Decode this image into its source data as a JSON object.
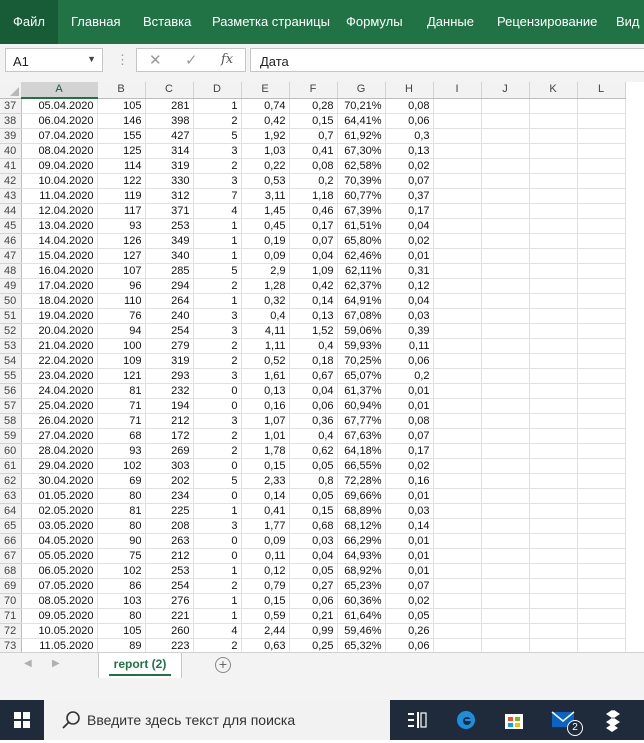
{
  "ribbon": {
    "tabs": [
      "Файл",
      "Главная",
      "Вставка",
      "Разметка страницы",
      "Формулы",
      "Данные",
      "Рецензирование",
      "Вид"
    ],
    "accent": "#217346"
  },
  "formula_bar": {
    "name_box": "A1",
    "cancel_icon": "close-icon",
    "enter_icon": "check-icon",
    "fx_label": "fx",
    "value": "Дата"
  },
  "grid": {
    "columns": [
      "A",
      "B",
      "C",
      "D",
      "E",
      "F",
      "G",
      "H",
      "I",
      "J",
      "K",
      "L"
    ],
    "rows": [
      [
        "37",
        "05.04.2020",
        "105",
        "281",
        "1",
        "0,74",
        "0,28",
        "70,21%",
        "0,08"
      ],
      [
        "38",
        "06.04.2020",
        "146",
        "398",
        "2",
        "0,42",
        "0,15",
        "64,41%",
        "0,06"
      ],
      [
        "39",
        "07.04.2020",
        "155",
        "427",
        "5",
        "1,92",
        "0,7",
        "61,92%",
        "0,3"
      ],
      [
        "40",
        "08.04.2020",
        "125",
        "314",
        "3",
        "1,03",
        "0,41",
        "67,30%",
        "0,13"
      ],
      [
        "41",
        "09.04.2020",
        "114",
        "319",
        "2",
        "0,22",
        "0,08",
        "62,58%",
        "0,02"
      ],
      [
        "42",
        "10.04.2020",
        "122",
        "330",
        "3",
        "0,53",
        "0,2",
        "70,39%",
        "0,07"
      ],
      [
        "43",
        "11.04.2020",
        "119",
        "312",
        "7",
        "3,11",
        "1,18",
        "60,77%",
        "0,37"
      ],
      [
        "44",
        "12.04.2020",
        "117",
        "371",
        "4",
        "1,45",
        "0,46",
        "67,39%",
        "0,17"
      ],
      [
        "45",
        "13.04.2020",
        "93",
        "253",
        "1",
        "0,45",
        "0,17",
        "61,51%",
        "0,04"
      ],
      [
        "46",
        "14.04.2020",
        "126",
        "349",
        "1",
        "0,19",
        "0,07",
        "65,80%",
        "0,02"
      ],
      [
        "47",
        "15.04.2020",
        "127",
        "340",
        "1",
        "0,09",
        "0,04",
        "62,46%",
        "0,01"
      ],
      [
        "48",
        "16.04.2020",
        "107",
        "285",
        "5",
        "2,9",
        "1,09",
        "62,11%",
        "0,31"
      ],
      [
        "49",
        "17.04.2020",
        "96",
        "294",
        "2",
        "1,28",
        "0,42",
        "62,37%",
        "0,12"
      ],
      [
        "50",
        "18.04.2020",
        "110",
        "264",
        "1",
        "0,32",
        "0,14",
        "64,91%",
        "0,04"
      ],
      [
        "51",
        "19.04.2020",
        "76",
        "240",
        "3",
        "0,4",
        "0,13",
        "67,08%",
        "0,03"
      ],
      [
        "52",
        "20.04.2020",
        "94",
        "254",
        "3",
        "4,11",
        "1,52",
        "59,06%",
        "0,39"
      ],
      [
        "53",
        "21.04.2020",
        "100",
        "279",
        "2",
        "1,11",
        "0,4",
        "59,93%",
        "0,11"
      ],
      [
        "54",
        "22.04.2020",
        "109",
        "319",
        "2",
        "0,52",
        "0,18",
        "70,25%",
        "0,06"
      ],
      [
        "55",
        "23.04.2020",
        "121",
        "293",
        "3",
        "1,61",
        "0,67",
        "65,07%",
        "0,2"
      ],
      [
        "56",
        "24.04.2020",
        "81",
        "232",
        "0",
        "0,13",
        "0,04",
        "61,37%",
        "0,01"
      ],
      [
        "57",
        "25.04.2020",
        "71",
        "194",
        "0",
        "0,16",
        "0,06",
        "60,94%",
        "0,01"
      ],
      [
        "58",
        "26.04.2020",
        "71",
        "212",
        "3",
        "1,07",
        "0,36",
        "67,77%",
        "0,08"
      ],
      [
        "59",
        "27.04.2020",
        "68",
        "172",
        "2",
        "1,01",
        "0,4",
        "67,63%",
        "0,07"
      ],
      [
        "60",
        "28.04.2020",
        "93",
        "269",
        "2",
        "1,78",
        "0,62",
        "64,18%",
        "0,17"
      ],
      [
        "61",
        "29.04.2020",
        "102",
        "303",
        "0",
        "0,15",
        "0,05",
        "66,55%",
        "0,02"
      ],
      [
        "62",
        "30.04.2020",
        "69",
        "202",
        "5",
        "2,33",
        "0,8",
        "72,28%",
        "0,16"
      ],
      [
        "63",
        "01.05.2020",
        "80",
        "234",
        "0",
        "0,14",
        "0,05",
        "69,66%",
        "0,01"
      ],
      [
        "64",
        "02.05.2020",
        "81",
        "225",
        "1",
        "0,41",
        "0,15",
        "68,89%",
        "0,03"
      ],
      [
        "65",
        "03.05.2020",
        "80",
        "208",
        "3",
        "1,77",
        "0,68",
        "68,12%",
        "0,14"
      ],
      [
        "66",
        "04.05.2020",
        "90",
        "263",
        "0",
        "0,09",
        "0,03",
        "66,29%",
        "0,01"
      ],
      [
        "67",
        "05.05.2020",
        "75",
        "212",
        "0",
        "0,11",
        "0,04",
        "64,93%",
        "0,01"
      ],
      [
        "68",
        "06.05.2020",
        "102",
        "253",
        "1",
        "0,12",
        "0,05",
        "68,92%",
        "0,01"
      ],
      [
        "69",
        "07.05.2020",
        "86",
        "254",
        "2",
        "0,79",
        "0,27",
        "65,23%",
        "0,07"
      ],
      [
        "70",
        "08.05.2020",
        "103",
        "276",
        "1",
        "0,15",
        "0,06",
        "60,36%",
        "0,02"
      ],
      [
        "71",
        "09.05.2020",
        "80",
        "221",
        "1",
        "0,59",
        "0,21",
        "61,64%",
        "0,05"
      ],
      [
        "72",
        "10.05.2020",
        "105",
        "260",
        "4",
        "2,44",
        "0,99",
        "59,46%",
        "0,26"
      ],
      [
        "73",
        "11.05.2020",
        "89",
        "223",
        "2",
        "0,63",
        "0,25",
        "65,32%",
        "0,06"
      ]
    ]
  },
  "sheets": {
    "tabs": [
      "report (2)"
    ],
    "active": "report (2)",
    "add_icon": "plus-icon"
  },
  "taskbar": {
    "start_icon": "windows-icon",
    "search_placeholder": "Введите здесь текст для поиска",
    "icons": [
      "task-view-icon",
      "edge-icon",
      "store-icon",
      "mail-icon",
      "dropbox-icon"
    ],
    "mail_badge": "2"
  }
}
